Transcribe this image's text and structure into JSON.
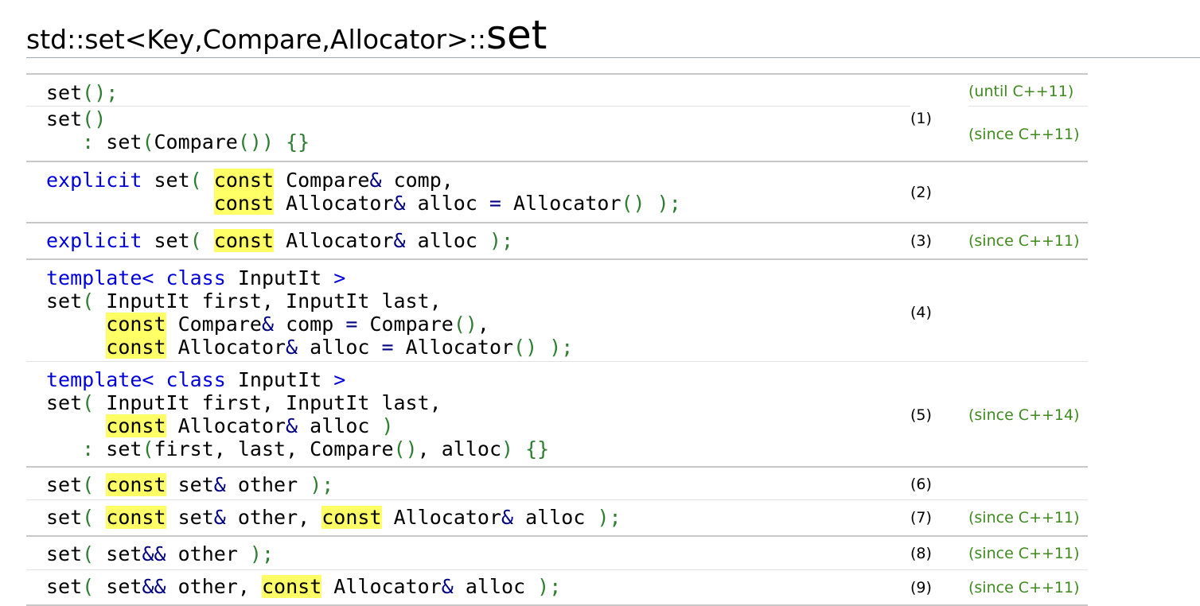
{
  "heading": {
    "prefix": "std::set<Key,Compare,Allocator>::",
    "name": "set"
  },
  "code_tokens": {
    "set": "set",
    "explicit": "explicit",
    "template": "template<",
    "class": "class",
    "const": "const"
  },
  "rows": [
    {
      "number": "(1)",
      "versions": [
        "(until C++11)",
        "(since C++11)"
      ]
    },
    {
      "number": "(2)",
      "version": ""
    },
    {
      "number": "(3)",
      "version": "(since C++11)"
    },
    {
      "number": "(4)",
      "version": ""
    },
    {
      "number": "(5)",
      "version": "(since C++14)"
    },
    {
      "number": "(6)",
      "version": ""
    },
    {
      "number": "(7)",
      "version": "(since C++11)"
    },
    {
      "number": "(8)",
      "version": "(since C++11)"
    },
    {
      "number": "(9)",
      "version": "(since C++11)"
    }
  ],
  "colors": {
    "keyword": "#0000dd",
    "punctuation": "#2e7d32",
    "highlight": "#ffff66",
    "version": "#3e8a1e"
  }
}
